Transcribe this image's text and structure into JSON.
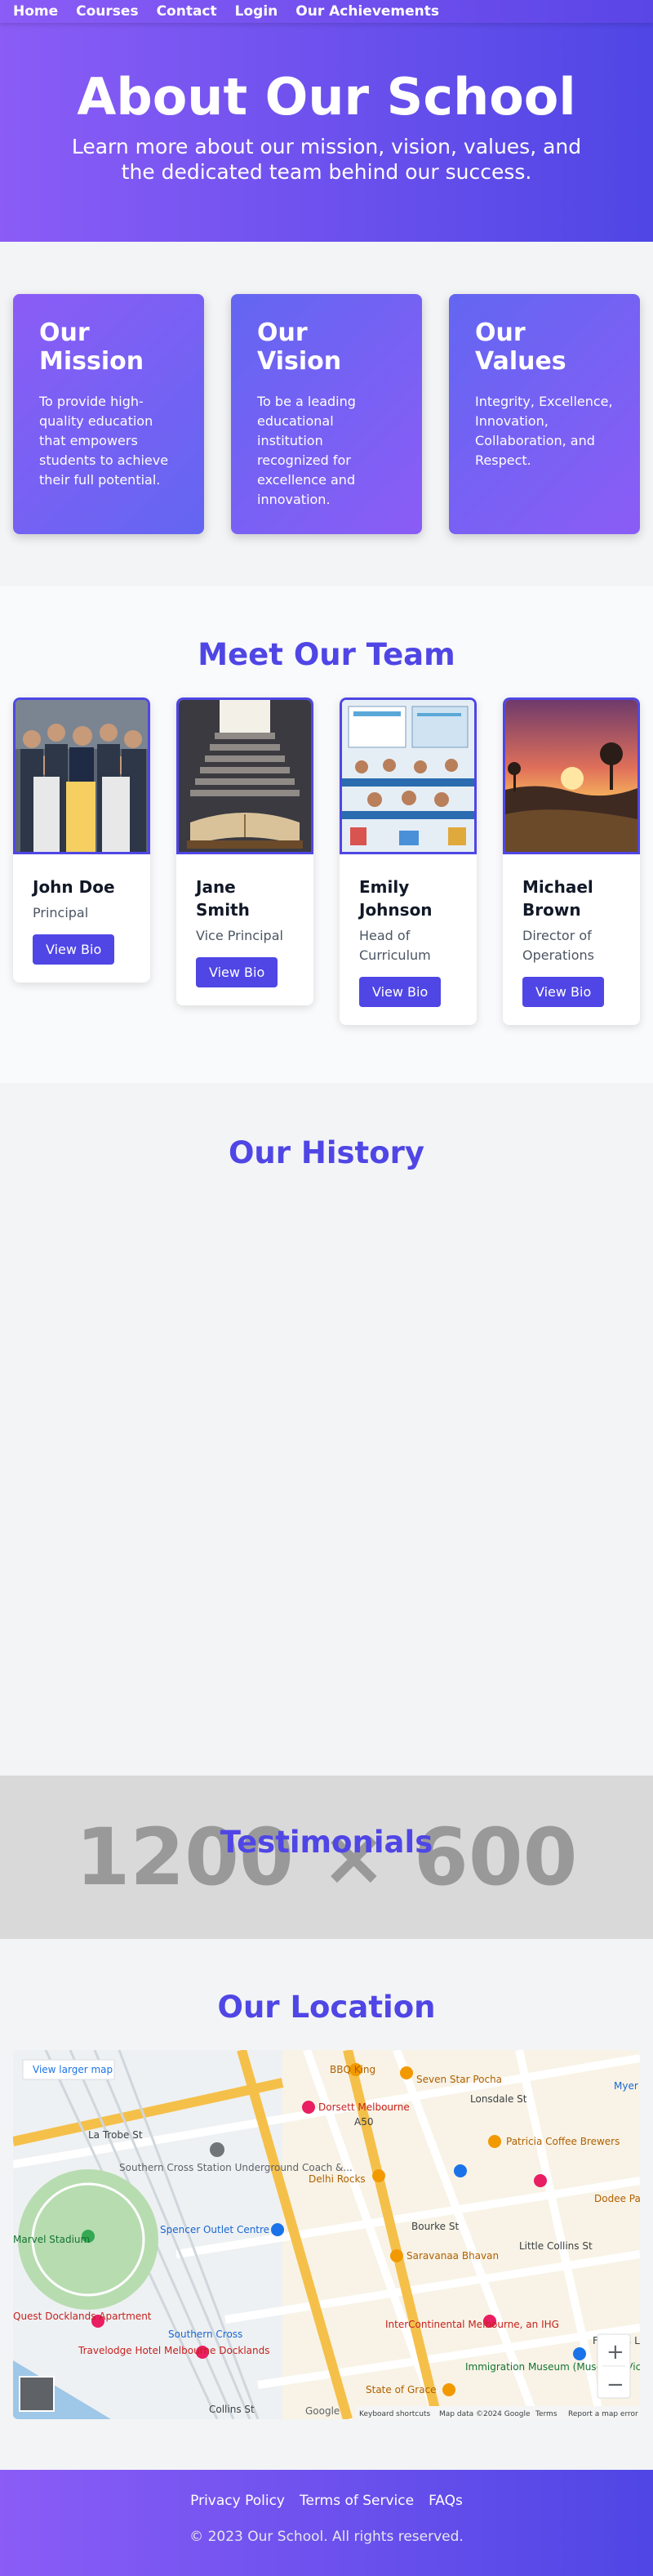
{
  "nav": {
    "items": [
      "Home",
      "Courses",
      "Contact",
      "Login",
      "Our Achievements"
    ]
  },
  "hero": {
    "title": "About Our School",
    "subtitle": "Learn more about our mission, vision, values, and the dedicated team behind our success."
  },
  "values": [
    {
      "title": "Our Mission",
      "text": "To provide high-quality education that empowers students to achieve their full potential."
    },
    {
      "title": "Our Vision",
      "text": "To be a leading educational institution recognized for excellence and innovation."
    },
    {
      "title": "Our Values",
      "text": "Integrity, Excellence, Innovation, Collaboration, and Respect."
    }
  ],
  "team": {
    "title": "Meet Our Team",
    "members": [
      {
        "name": "John Doe",
        "role": "Principal",
        "button": "View Bio",
        "photo": "group-photo"
      },
      {
        "name": "Jane Smith",
        "role": "Vice Principal",
        "button": "View Bio",
        "photo": "book-stairs-photo"
      },
      {
        "name": "Emily Johnson",
        "role": "Head of Curriculum",
        "button": "View Bio",
        "photo": "classroom-illustration"
      },
      {
        "name": "Michael Brown",
        "role": "Director of Operations",
        "button": "View Bio",
        "photo": "sunset-landscape"
      }
    ]
  },
  "history": {
    "title": "Our History"
  },
  "testimonials": {
    "title": "Testimonials",
    "placeholder": "1200 × 600"
  },
  "location": {
    "title": "Our Location",
    "map": {
      "larger_map_link": "View larger map",
      "labels": [
        "BBQ King",
        "Seven Star Pocha",
        "Dorsett Melbourne",
        "Lonsdale St",
        "La Trobe St",
        "Patricia Coffee Brewers",
        "Southern Cross Station Underground Coach &...",
        "Delhi Rocks",
        "Dodee Pa",
        "Marvel Stadium",
        "Spencer Outlet Centre",
        "Bourke St",
        "Little Collins St",
        "Saravanaa Bhavan",
        "Quest Docklands Apartment",
        "Southern Cross",
        "InterContinental Melbourne, an IHG",
        "Travelodge Hotel Melbourne Docklands",
        "Immigration Museum (Museums Victoria)",
        "State of Grace",
        "Collins St",
        "Flinders La",
        "Myer",
        "A50"
      ],
      "footer": [
        "Keyboard shortcuts",
        "Map data ©2024 Google",
        "Terms",
        "Report a map error"
      ],
      "zoom_in": "+",
      "zoom_out": "−",
      "google": "Google"
    }
  },
  "footer": {
    "links": [
      "Privacy Policy",
      "Terms of Service",
      "FAQs"
    ],
    "copyright": "© 2023 Our School. All rights reserved."
  }
}
